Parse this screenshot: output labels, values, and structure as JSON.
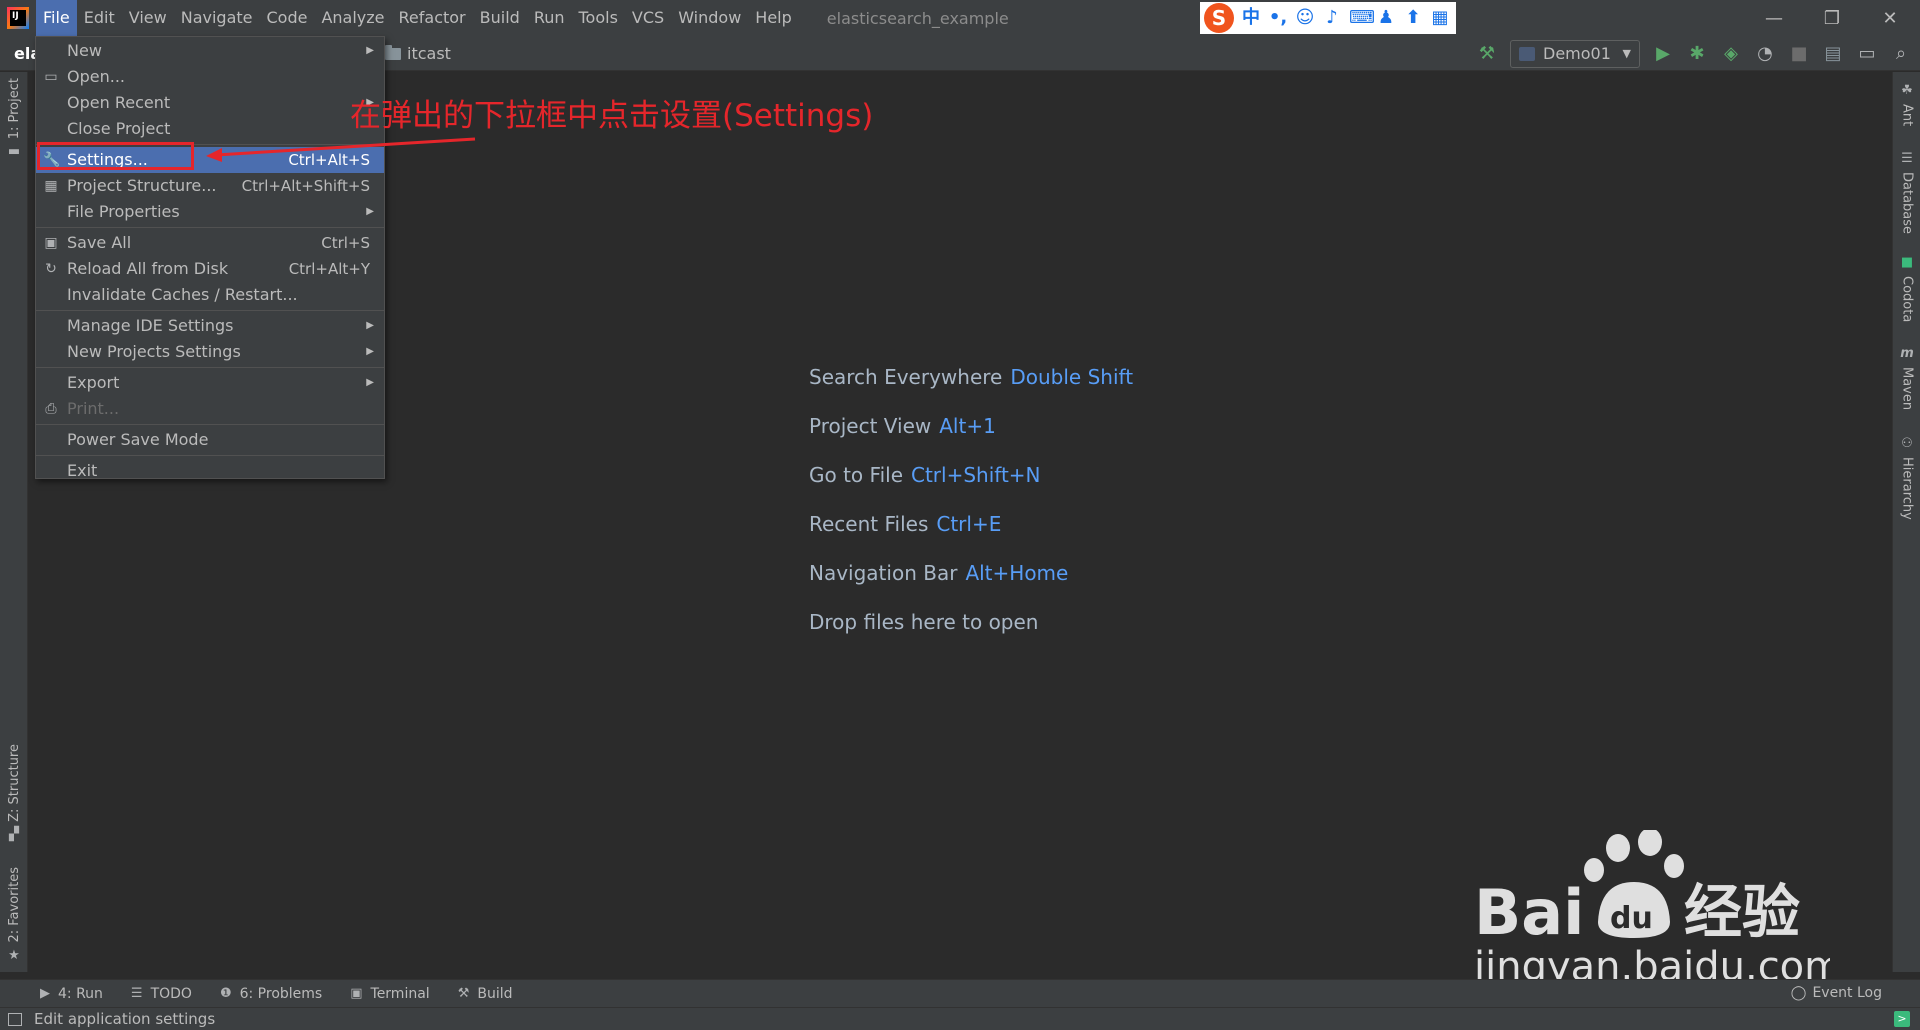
{
  "window": {
    "title": "elasticsearch_example",
    "menus": [
      "File",
      "Edit",
      "View",
      "Navigate",
      "Code",
      "Analyze",
      "Refactor",
      "Build",
      "Run",
      "Tools",
      "VCS",
      "Window",
      "Help"
    ],
    "active_menu": "File"
  },
  "ime": {
    "logo": "S",
    "lang": "中",
    "punct": "•,"
  },
  "navbar": {
    "project": "ela",
    "crumb": "itcast",
    "run_config": "Demo01"
  },
  "file_menu": {
    "items": [
      {
        "label": "New",
        "shortcut": "",
        "submenu": true,
        "icon": ""
      },
      {
        "label": "Open...",
        "shortcut": "",
        "submenu": false,
        "icon": "folder-open-icon"
      },
      {
        "label": "Open Recent",
        "shortcut": "",
        "submenu": true,
        "icon": ""
      },
      {
        "label": "Close Project",
        "shortcut": "",
        "submenu": false,
        "icon": ""
      },
      {
        "label": "Settings...",
        "shortcut": "Ctrl+Alt+S",
        "submenu": false,
        "icon": "wrench-icon",
        "selected": true
      },
      {
        "label": "Project Structure...",
        "shortcut": "Ctrl+Alt+Shift+S",
        "submenu": false,
        "icon": "project-structure-icon"
      },
      {
        "label": "File Properties",
        "shortcut": "",
        "submenu": true,
        "icon": ""
      },
      {
        "label": "Save All",
        "shortcut": "Ctrl+S",
        "submenu": false,
        "icon": "save-icon"
      },
      {
        "label": "Reload All from Disk",
        "shortcut": "Ctrl+Alt+Y",
        "submenu": false,
        "icon": "reload-icon"
      },
      {
        "label": "Invalidate Caches / Restart...",
        "shortcut": "",
        "submenu": false,
        "icon": ""
      },
      {
        "label": "Manage IDE Settings",
        "shortcut": "",
        "submenu": true,
        "icon": ""
      },
      {
        "label": "New Projects Settings",
        "shortcut": "",
        "submenu": true,
        "icon": ""
      },
      {
        "label": "Export",
        "shortcut": "",
        "submenu": true,
        "icon": ""
      },
      {
        "label": "Print...",
        "shortcut": "",
        "submenu": false,
        "icon": "print-icon",
        "disabled": true
      },
      {
        "label": "Power Save Mode",
        "shortcut": "",
        "submenu": false,
        "icon": ""
      },
      {
        "label": "Exit",
        "shortcut": "",
        "submenu": false,
        "icon": ""
      }
    ]
  },
  "annotation": {
    "text": "在弹出的下拉框中点击设置(Settings)",
    "color": "#e5262b"
  },
  "editor_hints": [
    {
      "action": "Search Everywhere",
      "shortcut": "Double Shift"
    },
    {
      "action": "Project View",
      "shortcut": "Alt+1"
    },
    {
      "action": "Go to File",
      "shortcut": "Ctrl+Shift+N"
    },
    {
      "action": "Recent Files",
      "shortcut": "Ctrl+E"
    },
    {
      "action": "Navigation Bar",
      "shortcut": "Alt+Home"
    },
    {
      "action": "Drop files here to open",
      "shortcut": ""
    }
  ],
  "left_tabs": {
    "project": "1: Project",
    "structure": "Z: Structure",
    "favorites": "2: Favorites"
  },
  "right_tabs": [
    "Ant",
    "Database",
    "Codota",
    "Maven",
    "Hierarchy"
  ],
  "bottom_tabs": [
    {
      "label": "4: Run",
      "icon": "run-icon"
    },
    {
      "label": "TODO",
      "icon": "list-icon"
    },
    {
      "label": "6: Problems",
      "icon": "problems-icon"
    },
    {
      "label": "Terminal",
      "icon": "terminal-icon"
    },
    {
      "label": "Build",
      "icon": "hammer-icon"
    }
  ],
  "event_log": "Event Log",
  "status_text": "Edit application settings",
  "watermark": {
    "brand": "Bai",
    "du": "du",
    "cn": "经验",
    "url": "jingyan.baidu.com"
  },
  "colors": {
    "selection": "#4b6eaf",
    "shortcut_blue": "#589df6",
    "annotation_red": "#e5262b",
    "background": "#2b2b2b",
    "panel": "#3c3f41"
  }
}
